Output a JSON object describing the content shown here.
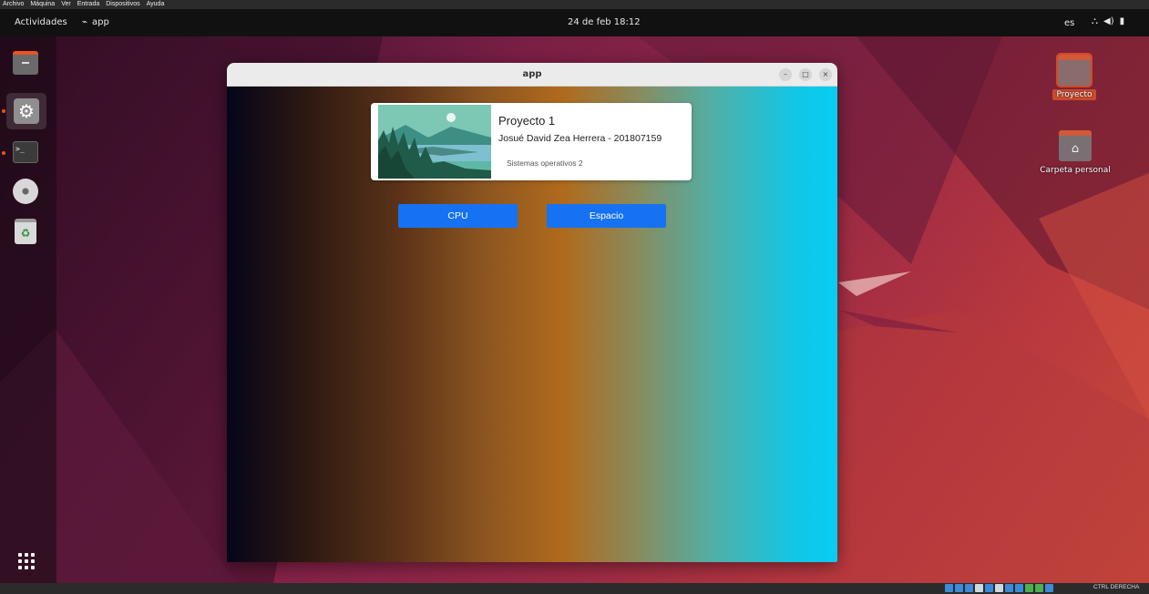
{
  "vbox_menu": [
    "Archivo",
    "Máquina",
    "Ver",
    "Entrada",
    "Dispositivos",
    "Ayuda"
  ],
  "topbar": {
    "activities": "Actividades",
    "app_name": "app",
    "clock": "24 de feb  18:12",
    "language": "es"
  },
  "desktop_icons": [
    {
      "label": "Proyecto",
      "icon": "folder-icon",
      "selected": true
    },
    {
      "label": "Carpeta personal",
      "icon": "home-folder-icon",
      "selected": false
    }
  ],
  "window": {
    "title": "app",
    "card": {
      "title": "Proyecto 1",
      "subtitle": "Josué David Zea Herrera - 201807159",
      "course": "Sistemas operativos 2"
    },
    "buttons": {
      "cpu": "CPU",
      "space": "Espacio"
    }
  },
  "statusbar": {
    "host_key": "CTRL DERECHA"
  },
  "colors": {
    "button": "#1672f2",
    "ubuntu_accent": "#e95420",
    "gradient": [
      "#05051a",
      "#b06a1d",
      "#07cdf2"
    ]
  }
}
